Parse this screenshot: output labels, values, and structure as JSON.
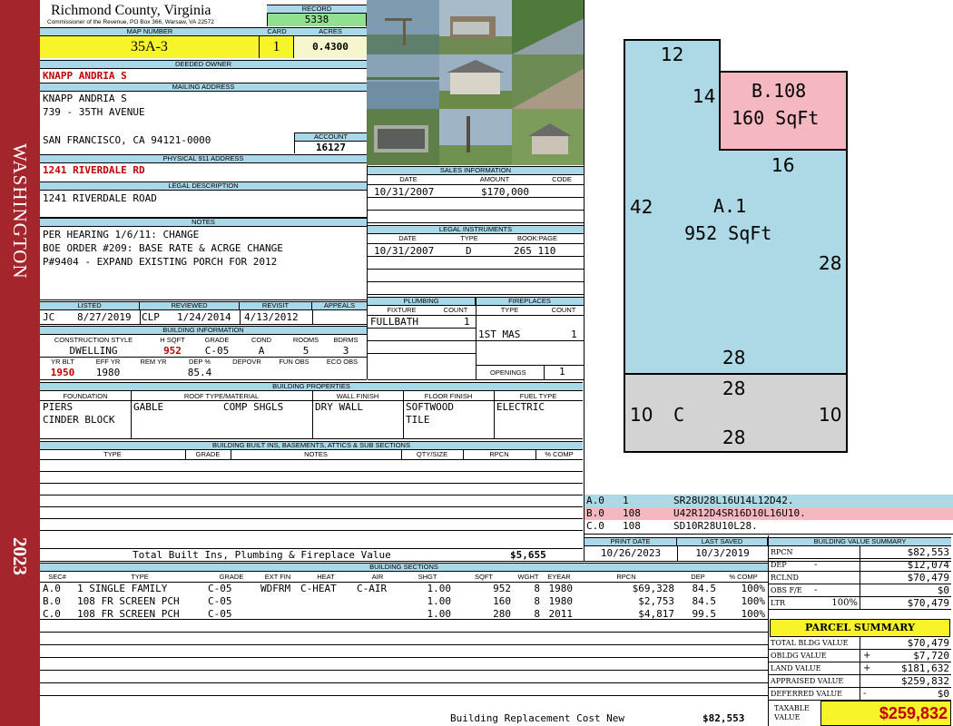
{
  "side": {
    "district": "WASHINGTON",
    "year": "2023"
  },
  "header": {
    "county": "Richmond County, Virginia",
    "commissioner": "Commissioner of the Revenue, PO Box 366, Warsaw, VA 22572",
    "record_label": "RECORD",
    "record": "5338",
    "map_label": "MAP NUMBER",
    "map": "35A-3",
    "card_label": "CARD",
    "card": "1",
    "acres_label": "ACRES",
    "acres": "0.4300"
  },
  "owner": {
    "deeded_label": "DEEDED OWNER",
    "deeded": "KNAPP ANDRIA S",
    "mailing_label": "MAILING ADDRESS",
    "mailing": [
      "KNAPP ANDRIA S",
      "739  - 35TH AVENUE",
      "",
      "SAN FRANCISCO, CA 94121-0000"
    ],
    "account_label": "ACCOUNT",
    "account": "16127",
    "physical_label": "PHYSICAL 911 ADDRESS",
    "physical": "1241 RIVERDALE RD",
    "legal_label": "LEGAL DESCRIPTION",
    "legal": "1241 RIVERDALE ROAD",
    "notes_label": "NOTES",
    "notes": [
      "PER HEARING 1/6/11: CHANGE",
      "BOE ORDER #209: BASE RATE & ACRGE CHANGE",
      "P#9404 - EXPAND EXISTING PORCH FOR 2012"
    ]
  },
  "review": {
    "labels": [
      "LISTED",
      "REVIEWED",
      "REVISIT",
      "APPEALS"
    ],
    "listed_by": "JC",
    "listed": "8/27/2019",
    "reviewed_by": "CLP",
    "reviewed": "1/24/2014",
    "revisit": "4/13/2012",
    "appeals": ""
  },
  "building_info": {
    "title": "BUILDING INFORMATION",
    "labels1": [
      "CONSTRUCTION STYLE",
      "H SQFT",
      "GRADE",
      "COND",
      "ROOMS",
      "BDRMS"
    ],
    "values1": [
      "DWELLING",
      "952",
      "C-05",
      "A",
      "5",
      "3"
    ],
    "labels2": [
      "YR BLT",
      "EFF YR",
      "REM YR",
      "DEP %",
      "DEPOVR",
      "FUN OBS",
      "ECO OBS"
    ],
    "values2": [
      "1950",
      "1980",
      "",
      "85.4",
      "",
      "",
      ""
    ]
  },
  "sales": {
    "title": "SALES INFORMATION",
    "labels": [
      "DATE",
      "AMOUNT",
      "CODE"
    ],
    "rows": [
      [
        "10/31/2007",
        "$170,000",
        ""
      ]
    ]
  },
  "legal_instruments": {
    "title": "LEGAL INSTRUMENTS",
    "labels": [
      "DATE",
      "TYPE",
      "BOOK:PAGE"
    ],
    "rows": [
      [
        "10/31/2007",
        "D",
        "265 110"
      ]
    ]
  },
  "plumbing": {
    "title": "PLUMBING",
    "labels": [
      "FIXTURE",
      "COUNT"
    ],
    "fixture": "FULLBATH",
    "count": "1"
  },
  "fireplaces": {
    "title": "FIREPLACES",
    "labels": [
      "TYPE",
      "COUNT"
    ],
    "type": "1ST MAS",
    "count": "1",
    "openings_label": "OPENINGS",
    "openings": "1"
  },
  "properties": {
    "title": "BUILDING PROPERTIES",
    "labels": [
      "FOUNDATION",
      "ROOF TYPE/MATERIAL",
      "WALL FINISH",
      "FLOOR FINISH",
      "FUEL TYPE"
    ],
    "foundation": [
      "PIERS",
      "CINDER BLOCK"
    ],
    "roof_type": "GABLE",
    "roof_mat": "COMP SHGLS",
    "wall": "DRY WALL",
    "floor": [
      "SOFTWOOD",
      "TILE"
    ],
    "fuel": "ELECTRIC"
  },
  "builtins": {
    "title": "BUILDING BUILT INS, BASEMENTS, ATTICS & SUB SECTIONS",
    "labels": [
      "TYPE",
      "GRADE",
      "NOTES",
      "QTY/SIZE",
      "RPCN",
      "% COMP"
    ],
    "total_label": "Total Built Ins, Plumbing & Fireplace Value",
    "total": "$5,655"
  },
  "dates": {
    "print_label": "PRINT DATE",
    "print": "10/26/2023",
    "saved_label": "LAST SAVED",
    "saved": "10/3/2019"
  },
  "sketch": {
    "dims": {
      "a_top": "12",
      "a_step": "14",
      "a_left": "42",
      "a_right": "28",
      "a_bottom": "28",
      "b_right": "16",
      "c_top": "28",
      "c_left": "10",
      "c_right": "10",
      "c_bottom": "28"
    },
    "a_label": "A.1",
    "a_area": "952 SqFt",
    "b_label": "B.108",
    "b_area": "160 SqFt",
    "c_label": "C",
    "colors": {
      "a": "#add8e6",
      "b": "#f5b8c0",
      "c": "#d3d3d3"
    },
    "codes": [
      {
        "id": "A.0",
        "n": "1",
        "code": "SR28U28L16U14L12D42.",
        "color": "#add8e6"
      },
      {
        "id": "B.0",
        "n": "108",
        "code": "U42R12D4SR16D10L16U10.",
        "color": "#f5b8c0"
      },
      {
        "id": "C.0",
        "n": "108",
        "code": "SD10R28U10L28.",
        "color": "#ffffff"
      }
    ]
  },
  "sections": {
    "title": "BUILDING SECTIONS",
    "labels": [
      "SEC#",
      "TYPE",
      "GRADE",
      "EXT FIN",
      "HEAT",
      "AIR",
      "SHGT",
      "SQFT",
      "WGHT",
      "EYEAR",
      "RPCN",
      "DEP",
      "% COMP"
    ],
    "rows": [
      [
        "A.0",
        "1 SINGLE FAMILY",
        "C-05",
        "WDFRM",
        "C-HEAT",
        "C-AIR",
        "1.00",
        "952",
        "8",
        "1980",
        "$69,328",
        "84.5",
        "100%"
      ],
      [
        "B.0",
        "108 FR SCREEN PCH",
        "C-05",
        "",
        "",
        "",
        "1.00",
        "160",
        "8",
        "1980",
        "$2,753",
        "84.5",
        "100%"
      ],
      [
        "C.0",
        "108 FR SCREEN PCH",
        "C-05",
        "",
        "",
        "",
        "1.00",
        "280",
        "8",
        "2011",
        "$4,817",
        "99.5",
        "100%"
      ]
    ],
    "replacement_label": "Building Replacement Cost New",
    "replacement": "$82,553"
  },
  "value_summary": {
    "title": "BUILDING VALUE SUMMARY",
    "rows": [
      {
        "label": "RPCN",
        "sign": "",
        "value": "$82,553"
      },
      {
        "label": "DEP",
        "sign": "-",
        "value": "$12,074"
      },
      {
        "label": "RCLND",
        "sign": "",
        "value": "$70,479"
      },
      {
        "label": "OBS F/E",
        "sign": "-",
        "value": "$0"
      },
      {
        "label": "Ltr",
        "sign": "100%",
        "value": "$70,479"
      }
    ]
  },
  "parcel": {
    "title": "PARCEL SUMMARY",
    "rows": [
      {
        "label": "TOTAL BLDG VALUE",
        "sign": "",
        "value": "$70,479"
      },
      {
        "label": "OBLDG VALUE",
        "sign": "+",
        "value": "$7,720"
      },
      {
        "label": "LAND VALUE",
        "sign": "+",
        "value": "$181,632"
      },
      {
        "label": "APPRAISED VALUE",
        "sign": "",
        "value": "$259,832"
      },
      {
        "label": "DEFERRED VALUE",
        "sign": "-",
        "value": "$0"
      }
    ],
    "taxable_label": "TAXABLE VALUE",
    "taxable": "$259,832"
  }
}
